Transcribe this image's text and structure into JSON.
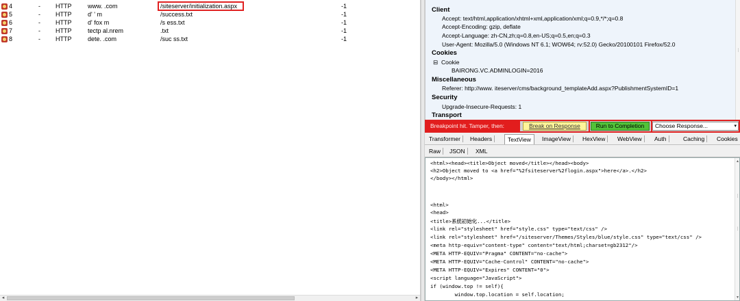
{
  "sessions": [
    {
      "num": "4",
      "result": "-",
      "protocol": "HTTP",
      "host": "www.          .com",
      "url": "/siteserver/initialization.aspx",
      "body": "-1"
    },
    {
      "num": "5",
      "result": "-",
      "protocol": "HTTP",
      "host": "d'   '         m",
      "url": "/success.txt",
      "body": "-1"
    },
    {
      "num": "6",
      "result": "-",
      "protocol": "HTTP",
      "host": "d'        fox   m",
      "url": "/s     ess.txt",
      "body": "-1"
    },
    {
      "num": "7",
      "result": "-",
      "protocol": "HTTP",
      "host": "   tectp   al.nrem",
      "url": "     .txt",
      "body": "-1"
    },
    {
      "num": "8",
      "result": "-",
      "protocol": "HTTP",
      "host": "dete.               .com",
      "url": "/suc  ss.txt",
      "body": "-1"
    }
  ],
  "request_headers": {
    "client_title": "Client",
    "accept": "Accept: text/html,application/xhtml+xml,application/xml;q=0.9,*/*;q=0.8",
    "accept_encoding": "Accept-Encoding: gzip, deflate",
    "accept_language": "Accept-Language: zh-CN,zh;q=0.8,en-US;q=0.5,en;q=0.3",
    "user_agent": "User-Agent: Mozilla/5.0 (Windows NT 6.1; WOW64; rv:52.0) Gecko/20100101 Firefox/52.0",
    "cookies_title": "Cookies",
    "cookie_node": "Cookie",
    "cookie_value": "BAIRONG.VC.ADMINLOGIN=2016",
    "misc_title": "Miscellaneous",
    "referer": "Referer: http://www.                  iteserver/cms/background_templateAdd.aspx?PublishmentSystemID=1",
    "security_title": "Security",
    "upgrade": "Upgrade-Insecure-Requests: 1",
    "transport_title": "Transport"
  },
  "breakpoint": {
    "text": "Breakpoint hit. Tamper, then:",
    "break_on_response": "Break on Response",
    "run_to_completion": "Run to Completion",
    "choose_response": "Choose Response..."
  },
  "tabs_row1": [
    "Transformer",
    "Headers",
    "TextView",
    "ImageView",
    "HexView",
    "WebView",
    "Auth",
    "Caching",
    "Cookies"
  ],
  "tabs_row2": [
    "Raw",
    "JSON",
    "XML"
  ],
  "active_tab": "TextView",
  "response_body": [
    "<html><head><title>Object moved</title></head><body>",
    "<h2>Object moved to <a href=\"%2fsiteserver%2flogin.aspx\">here</a>.</h2>",
    "</body></html>",
    "",
    "",
    "",
    "<html>",
    "<head>",
    "<title>系统初始化...</title>",
    "<link rel=\"stylesheet\" href=\"style.css\" type=\"text/css\" />",
    "<link rel=\"stylesheet\" href=\"/siteserver/Themes/Styles/blue/style.css\" type=\"text/css\" />",
    "<meta http-equiv=\"content-type\" content=\"text/html;charset=gb2312\"/>",
    "<META HTTP-EQUIV=\"Pragma\" CONTENT=\"no-cache\">",
    "<META HTTP-EQUIV=\"Cache-Control\" CONTENT=\"no-cache\">",
    "<META HTTP-EQUIV=\"Expires\" CONTENT=\"0\">",
    "<script language=\"JavaScript\">",
    "if (window.top != self){",
    "        window.top.location = self.location;"
  ],
  "colors": {
    "breakpoint_red": "#e21d1d",
    "break_yellow": "#fff59a",
    "run_green": "#52c239",
    "headers_bg": "#eef4fb"
  }
}
